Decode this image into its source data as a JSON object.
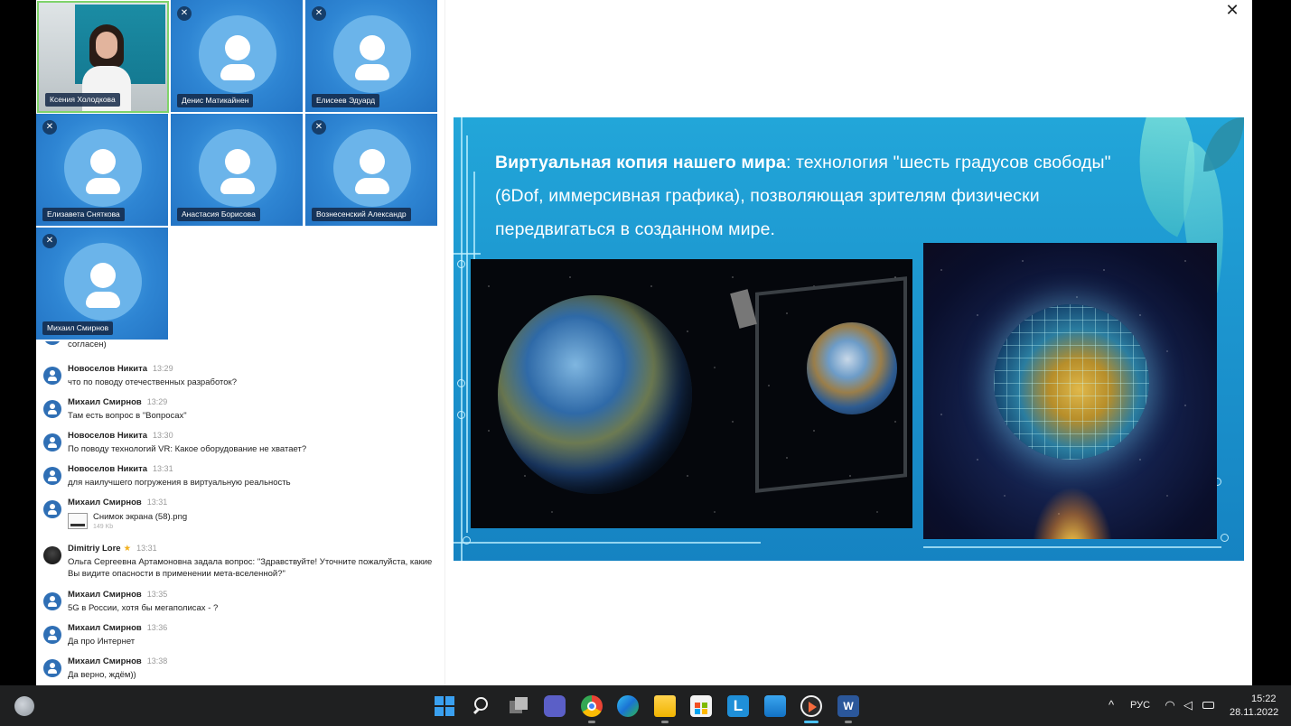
{
  "participants": [
    {
      "name": "Ксения Холодкова",
      "camera": true
    },
    {
      "name": "Денис Матикайнен",
      "camera": false
    },
    {
      "name": "Елисеев Эдуард",
      "camera": false
    },
    {
      "name": "Елизавета Сняткова",
      "camera": false
    },
    {
      "name": "Анастасия Борисова",
      "camera": false
    },
    {
      "name": "Вознесенский Александр",
      "camera": false
    },
    {
      "name": "Михаил Смирнов",
      "camera": false
    }
  ],
  "chat": {
    "partial_top": "согласен)",
    "messages": [
      {
        "author": "Новоселов Никита",
        "time": "13:29",
        "text": "что по поводу отечественных разработок?"
      },
      {
        "author": "Михаил Смирнов",
        "time": "13:29",
        "text": "Там есть вопрос в \"Вопросах\""
      },
      {
        "author": "Новоселов Никита",
        "time": "13:30",
        "text": "По поводу технологий VR: Какое оборудование не хватает?"
      },
      {
        "author": "Новоселов Никита",
        "time": "13:31",
        "text": "для наилучшего погружения в виртуальную реальность"
      },
      {
        "author": "Михаил Смирнов",
        "time": "13:31",
        "file_name": "Снимок экрана (58).png",
        "file_size": "149 Kb"
      },
      {
        "author": "Dimitriy Lore",
        "star": "★",
        "time": "13:31",
        "text": "Ольга Сергеевна Артамоновна задала вопрос: \"Здравствуйте! Уточните пожалуйста, какие Вы видите опасности в применении мета-вселенной?\""
      },
      {
        "author": "Михаил Смирнов",
        "time": "13:35",
        "text": "5G в России, хотя бы мегаполисах - ?"
      },
      {
        "author": "Михаил Смирнов",
        "time": "13:36",
        "text": "Да про Интернет"
      },
      {
        "author": "Михаил Смирнов",
        "time": "13:38",
        "text": "Да верно, ждём))"
      }
    ]
  },
  "slide": {
    "bold_part": "Виртуальная копия нашего мира",
    "rest_text": ": технология \"шесть градусов свободы\" (6Dof, иммерсивная графика), позволяющая зрителям физически передвигаться в созданном мире."
  },
  "window": {
    "close_glyph": "✕"
  },
  "taskbar": {
    "language": "РУС",
    "time": "15:22",
    "date": "28.11.2022",
    "apps": [
      "start",
      "search",
      "task-view",
      "teams",
      "chrome",
      "edge",
      "file-explorer",
      "store",
      "l-app",
      "mail",
      "media-player",
      "word"
    ]
  },
  "colors": {
    "tile_blue": "#2e85d3",
    "active_border": "#7fd36b",
    "slide_blue": "#1d97d0",
    "taskbar": "#1f2021",
    "accent": "#4cc2ff"
  }
}
